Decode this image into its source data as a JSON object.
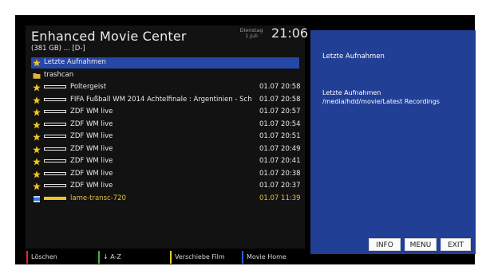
{
  "header": {
    "title": "Enhanced Movie Center",
    "subtitle": "(381 GB) ... [D-]",
    "day": "Dienstag",
    "date": "1.Juli",
    "time": "21:06"
  },
  "list": [
    {
      "title": "Letzte Aufnahmen",
      "icon": "star-icon",
      "date": "",
      "progress": null,
      "selected": true
    },
    {
      "title": "trashcan",
      "icon": "folder-icon",
      "date": "",
      "progress": null
    },
    {
      "title": "Poltergeist",
      "icon": "star-icon",
      "date": "01.07 20:58",
      "progress": 0
    },
    {
      "title": "FIFA Fußball WM 2014 Achtelfinale : Argentinien - Sch",
      "icon": "star-icon",
      "date": "01.07 20:58",
      "progress": 0
    },
    {
      "title": "ZDF WM live",
      "icon": "star-icon",
      "date": "01.07 20:57",
      "progress": 0
    },
    {
      "title": "ZDF WM live",
      "icon": "star-icon",
      "date": "01.07 20:54",
      "progress": 0
    },
    {
      "title": "ZDF WM live",
      "icon": "star-icon",
      "date": "01.07 20:51",
      "progress": 0
    },
    {
      "title": "ZDF WM live",
      "icon": "star-icon",
      "date": "01.07 20:49",
      "progress": 0
    },
    {
      "title": "ZDF WM live",
      "icon": "star-icon",
      "date": "01.07 20:41",
      "progress": 0
    },
    {
      "title": "ZDF WM live",
      "icon": "star-icon",
      "date": "01.07 20:38",
      "progress": 0
    },
    {
      "title": "ZDF WM live",
      "icon": "star-icon",
      "date": "01.07 20:37",
      "progress": 0
    },
    {
      "title": "lame-transc-720",
      "icon": "film-icon",
      "date": "01.07 11:39",
      "progress": 1.0,
      "current": true
    }
  ],
  "info": {
    "title": "Letzte Aufnahmen",
    "detail_name": "Letzte Aufnahmen",
    "detail_path": "/media/hdd/movie/Latest Recordings"
  },
  "buttons": {
    "info": "INFO",
    "menu": "MENU",
    "exit": "EXIT"
  },
  "color_keys": [
    {
      "label": "Löschen",
      "color": "#e0282d"
    },
    {
      "label": "↓ A-Z",
      "color": "#3cb43c"
    },
    {
      "label": "Verschiebe Film",
      "color": "#e6d22a"
    },
    {
      "label": "Movie Home",
      "color": "#2a5ee0"
    }
  ],
  "colors": {
    "selection": "#2747a8",
    "info_panel": "#223f96",
    "star": "#f2c422",
    "current_text": "#e6c13a"
  }
}
